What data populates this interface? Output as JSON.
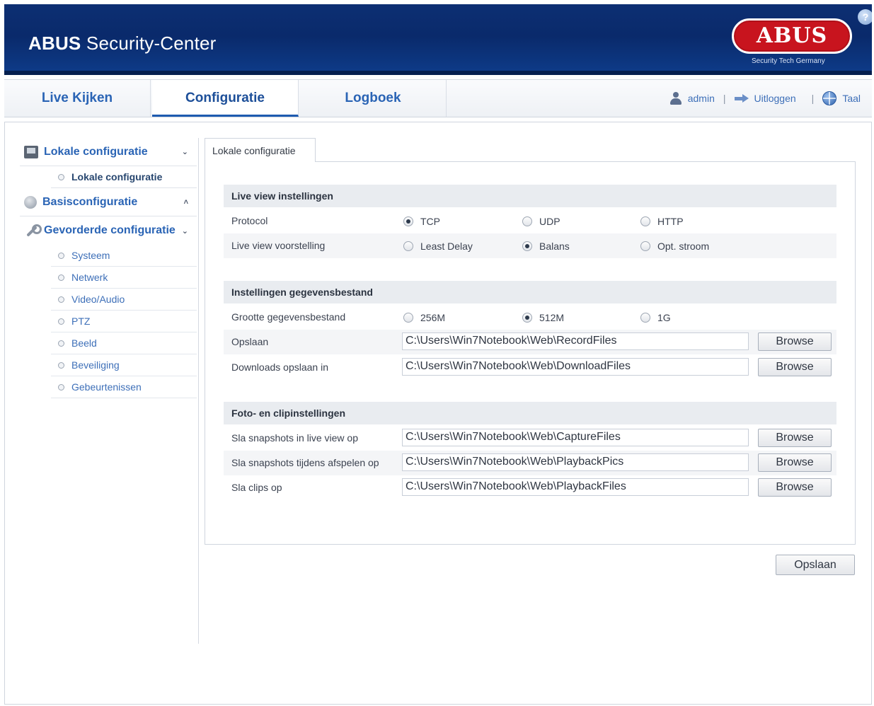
{
  "header": {
    "app_title_brand": "ABUS",
    "app_title_rest": "Security-Center",
    "logo_text": "ABUS",
    "logo_subtitle": "Security Tech Germany",
    "help_label": "?"
  },
  "nav": {
    "tabs": [
      {
        "label": "Live Kijken",
        "active": false
      },
      {
        "label": "Configuratie",
        "active": true
      },
      {
        "label": "Logboek",
        "active": false
      }
    ],
    "user": "admin",
    "separator": "|",
    "logout": "Uitloggen",
    "language": "Taal"
  },
  "sidebar": {
    "groups": [
      {
        "label": "Lokale configuratie",
        "icon": "computer-icon",
        "chevron": "⌄",
        "expanded": true,
        "items": [
          {
            "label": "Lokale configuratie",
            "current": true
          }
        ]
      },
      {
        "label": "Basisconfiguratie",
        "icon": "basis-icon",
        "chevron": "˄",
        "expanded": false,
        "items": []
      },
      {
        "label": "Gevorderde configuratie",
        "icon": "wrench-icon",
        "chevron": "⌄",
        "expanded": true,
        "items": [
          {
            "label": "Systeem"
          },
          {
            "label": "Netwerk"
          },
          {
            "label": "Video/Audio"
          },
          {
            "label": "PTZ"
          },
          {
            "label": "Beeld"
          },
          {
            "label": "Beveiliging"
          },
          {
            "label": "Gebeurtenissen"
          }
        ]
      }
    ]
  },
  "content": {
    "tab_label": "Lokale configuratie",
    "sections": {
      "live_view": {
        "title": "Live view instellingen",
        "protocol": {
          "label": "Protocol",
          "options": [
            "TCP",
            "UDP",
            "HTTP"
          ],
          "selected": "TCP"
        },
        "performance": {
          "label": "Live view voorstelling",
          "options": [
            "Least Delay",
            "Balans",
            "Opt. stroom"
          ],
          "selected": "Balans"
        }
      },
      "record_file": {
        "title": "Instellingen gegevensbestand",
        "size": {
          "label": "Grootte gegevensbestand",
          "options": [
            "256M",
            "512M",
            "1G"
          ],
          "selected": "512M"
        },
        "save_path": {
          "label": "Opslaan",
          "value": "C:\\Users\\Win7Notebook\\Web\\RecordFiles"
        },
        "download_path": {
          "label": "Downloads opslaan in",
          "value": "C:\\Users\\Win7Notebook\\Web\\DownloadFiles"
        }
      },
      "picture_clip": {
        "title": "Foto- en clipinstellingen",
        "snapshot_live": {
          "label": "Sla snapshots in live view op",
          "value": "C:\\Users\\Win7Notebook\\Web\\CaptureFiles"
        },
        "snapshot_playback": {
          "label": "Sla snapshots tijdens afspelen op",
          "value": "C:\\Users\\Win7Notebook\\Web\\PlaybackPics"
        },
        "clips": {
          "label": "Sla clips op",
          "value": "C:\\Users\\Win7Notebook\\Web\\PlaybackFiles"
        }
      }
    },
    "browse_label": "Browse",
    "save_label": "Opslaan"
  },
  "colors": {
    "header_bg": "#0a2a6b",
    "accent": "#2a64b5",
    "logo_red": "#c8141e"
  }
}
